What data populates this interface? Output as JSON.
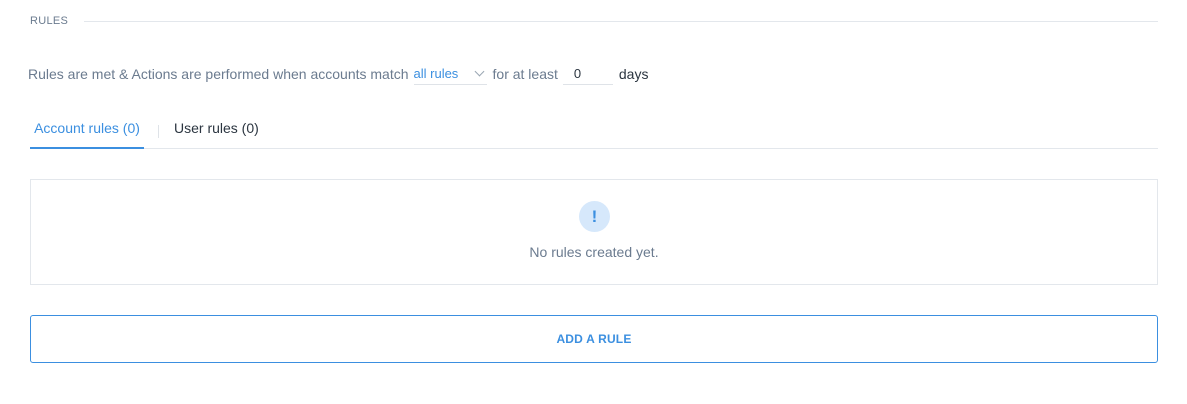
{
  "section": {
    "title": "RULES"
  },
  "rule_sentence": {
    "prefix": "Rules are met & Actions are performed when accounts match",
    "match_value": "all rules",
    "middle": "for at least",
    "days_value": "0",
    "suffix": "days"
  },
  "tabs": [
    {
      "label": "Account rules (0)",
      "active": true
    },
    {
      "label": "User rules (0)",
      "active": false
    }
  ],
  "empty_state": {
    "icon": "exclamation-icon",
    "glyph": "!",
    "message": "No rules created yet."
  },
  "add_rule_button": {
    "label": "ADD A RULE"
  },
  "colors": {
    "accent": "#3b8fe0",
    "text_muted": "#6b7b8f",
    "text_dark": "#2b3540",
    "border": "#e3e7ec",
    "icon_bg": "#d6e8fb"
  }
}
